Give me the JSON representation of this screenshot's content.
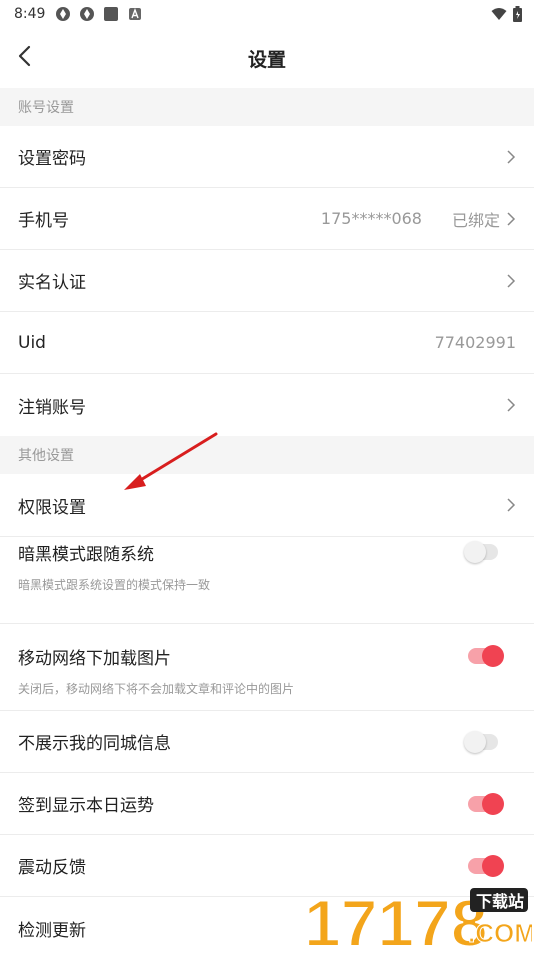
{
  "status_bar": {
    "time": "8:49"
  },
  "header": {
    "title": "设置"
  },
  "sections": [
    {
      "title": "账号设置",
      "items": [
        {
          "label": "设置密码",
          "chevron": true
        },
        {
          "label": "手机号",
          "value": "175*****068",
          "status": "已绑定",
          "chevron": true
        },
        {
          "label": "实名认证",
          "chevron": true
        },
        {
          "label": "Uid",
          "value": "77402991"
        },
        {
          "label": "注销账号",
          "chevron": true
        }
      ]
    },
    {
      "title": "其他设置",
      "items": [
        {
          "label": "权限设置",
          "chevron": true
        },
        {
          "label": "暗黑模式跟随系统",
          "sub": "暗黑模式跟系统设置的模式保持一致",
          "toggle": false
        },
        {
          "label": "移动网络下加载图片",
          "sub": "关闭后，移动网络下将不会加载文章和评论中的图片",
          "toggle": true
        },
        {
          "label": "不展示我的同城信息",
          "toggle": false
        },
        {
          "label": "签到显示本日运势",
          "toggle": true
        },
        {
          "label": "震动反馈",
          "toggle": true
        },
        {
          "label": "检测更新"
        }
      ]
    }
  ],
  "watermark": {
    "brand": "17178",
    "tag": "下载站",
    "domain": ".COM"
  },
  "colors": {
    "accent": "#f04352",
    "accent_light": "#f7a1a9",
    "section_bg": "#f5f5f5",
    "annotation_arrow": "#d81e1e"
  }
}
